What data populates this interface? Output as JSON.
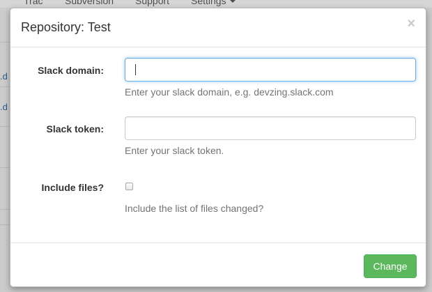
{
  "navbar": {
    "items": [
      "Trac",
      "Subversion",
      "Support",
      "Settings"
    ]
  },
  "background": {
    "link_fragments": [
      ".d",
      ".d"
    ]
  },
  "modal": {
    "title": "Repository: Test",
    "close_label": "×",
    "fields": {
      "slack_domain": {
        "label": "Slack domain:",
        "value": "",
        "help": "Enter your slack domain, e.g. devzing.slack.com"
      },
      "slack_token": {
        "label": "Slack token:",
        "value": "",
        "help": "Enter your slack token."
      },
      "include_files": {
        "label": "Include files?",
        "checked": false,
        "help": "Include the list of files changed?"
      }
    },
    "submit_label": "Change"
  },
  "colors": {
    "primary_button": "#5cb85c",
    "focus_border": "#66afe9",
    "help_text": "#737373"
  }
}
